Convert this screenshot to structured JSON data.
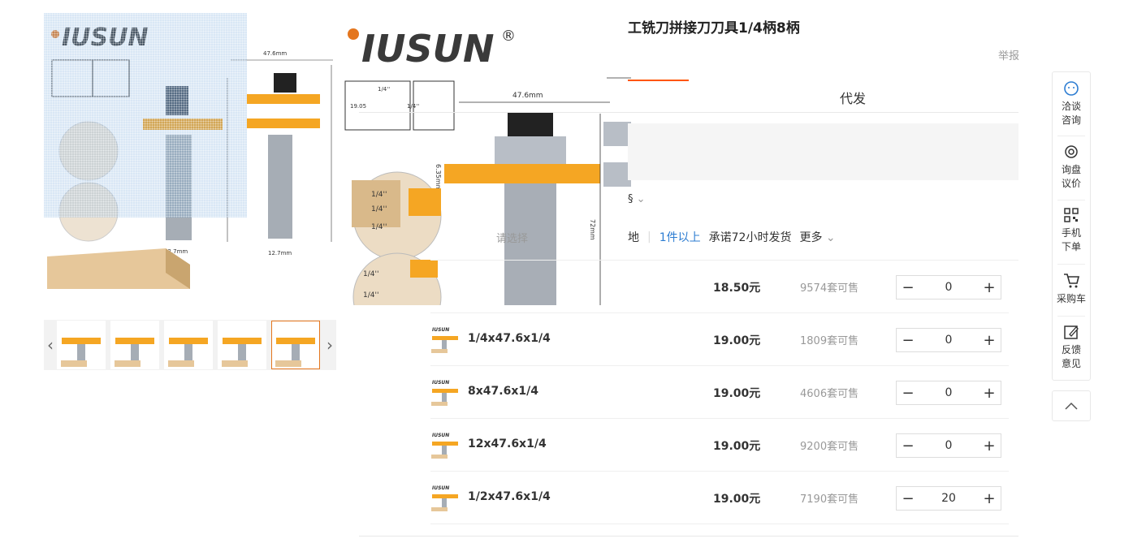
{
  "brand": {
    "logo_text": "IUSUN",
    "registered": "®"
  },
  "product": {
    "title": "工铣刀拼接刀刀具1/4柄8柄",
    "report_label": "举报",
    "diagram": {
      "width_label": "47.6mm",
      "shank_label": "12.7mm",
      "height_label": "72mm",
      "slot_label": "1/4''",
      "thick_label": "19.05",
      "cut_label": "6.35mm"
    }
  },
  "tabs": {
    "daifa": "代发"
  },
  "spec_label": "§",
  "shipping": {
    "origin": "地",
    "min_qty": "1件以上",
    "promise": "承诺72小时发货",
    "more": "更多"
  },
  "overlay_text": "请选择",
  "rows": [
    {
      "name": "",
      "price": "18.50元",
      "stock": "9574套可售",
      "qty": "0"
    },
    {
      "name": "1/4x47.6x1/4",
      "price": "19.00元",
      "stock": "1809套可售",
      "qty": "0"
    },
    {
      "name": "8x47.6x1/4",
      "price": "19.00元",
      "stock": "4606套可售",
      "qty": "0"
    },
    {
      "name": "12x47.6x1/4",
      "price": "19.00元",
      "stock": "9200套可售",
      "qty": "0"
    },
    {
      "name": "1/2x47.6x1/4",
      "price": "19.00元",
      "stock": "7190套可售",
      "qty": "20"
    }
  ],
  "stepper": {
    "minus": "−",
    "plus": "+"
  },
  "sidebar": {
    "items": [
      {
        "label1": "洽谈",
        "label2": "咨询",
        "icon": "chat-icon"
      },
      {
        "label1": "询盘",
        "label2": "议价",
        "icon": "target-icon"
      },
      {
        "label1": "手机",
        "label2": "下单",
        "icon": "qr-icon"
      },
      {
        "label1": "采购车",
        "label2": "",
        "icon": "cart-icon"
      },
      {
        "label1": "反馈",
        "label2": "意见",
        "icon": "edit-icon"
      }
    ]
  },
  "colors": {
    "accent": "#ff5500",
    "blue": "#2d7dd2",
    "logo_orange": "#e4761e",
    "bit_yellow": "#f5a623"
  }
}
